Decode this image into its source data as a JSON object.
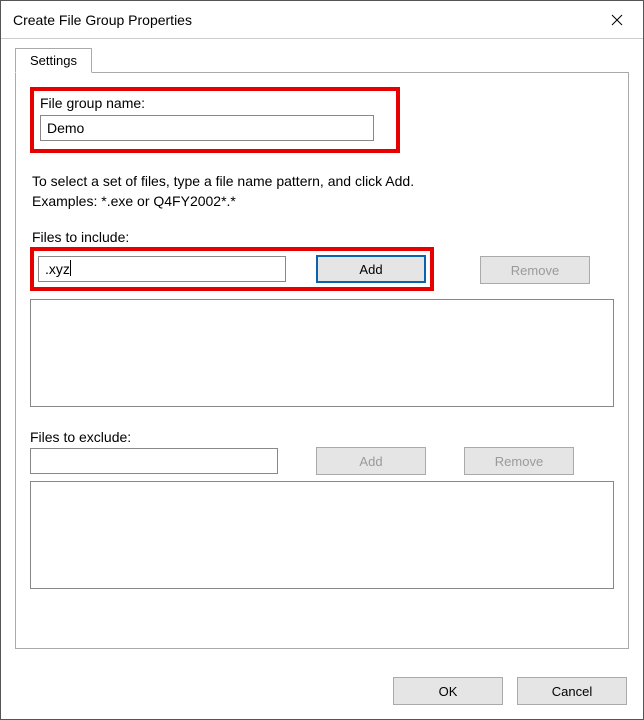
{
  "window_title": "Create File Group Properties",
  "tab_label": "Settings",
  "file_group_name_label": "File group name:",
  "file_group_name_value": "Demo",
  "help_line1": "To select a set of files, type a file name pattern, and click Add.",
  "help_line2": "Examples: *.exe or Q4FY2002*.*",
  "files_to_include_label": "Files to include:",
  "include_input_value": ".xyz",
  "add_button_label": "Add",
  "remove_button_label": "Remove",
  "files_to_exclude_label": "Files to exclude:",
  "exclude_input_value": "",
  "ok_button_label": "OK",
  "cancel_button_label": "Cancel"
}
